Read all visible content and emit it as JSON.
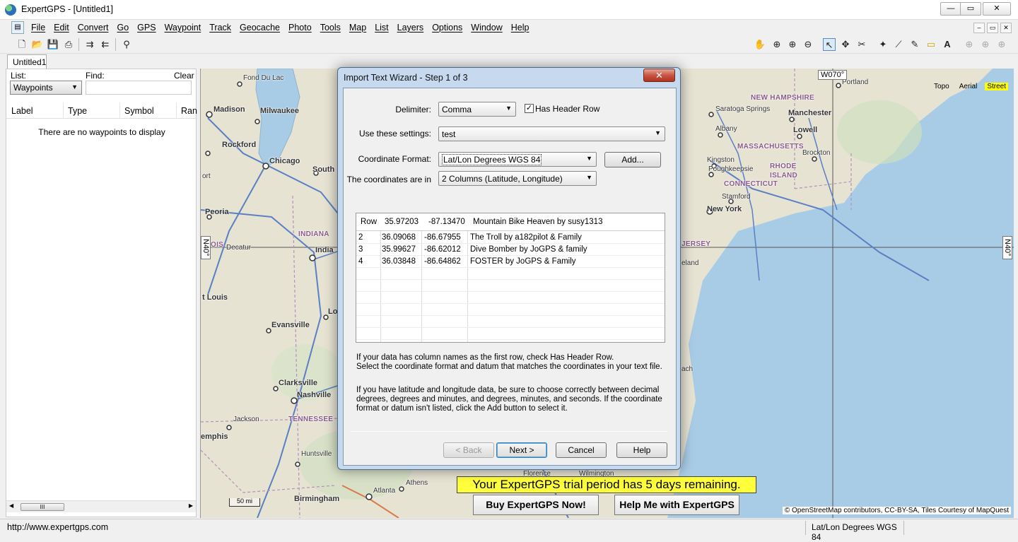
{
  "window": {
    "title": "ExpertGPS - [Untitled1]",
    "controls": {
      "minimize": "—",
      "restore": "▭",
      "close": "✕"
    }
  },
  "menu": [
    "File",
    "Edit",
    "Convert",
    "Go",
    "GPS",
    "Waypoint",
    "Track",
    "Geocache",
    "Photo",
    "Tools",
    "Map",
    "List",
    "Layers",
    "Options",
    "Window",
    "Help"
  ],
  "document_tab": "Untitled1",
  "left_panel": {
    "list_label": "List:",
    "find_label": "Find:",
    "clear_label": "Clear",
    "list_value": "Waypoints",
    "columns": [
      "Label",
      "Type",
      "Symbol",
      "Ran"
    ],
    "empty_message": "There are no waypoints to display",
    "scroll_thumb": "III"
  },
  "map": {
    "types": [
      "Topo",
      "Aerial",
      "Street"
    ],
    "active_type": "Street",
    "lon_tag": "W070°",
    "lat_tag_left": "N40°",
    "lat_tag_right": "N40°",
    "scale": "50 mi",
    "attribution": "© OpenStreetMap contributors, CC-BY-SA, Tiles Courtesy of MapQuest",
    "labels": {
      "fond_du_lac": "Fond Du Lac",
      "madison": "Madison",
      "milwaukee": "Milwaukee",
      "rockford": "Rockford",
      "chicago": "Chicago",
      "south": "South",
      "ort": "ort",
      "peoria": "Peoria",
      "indiana": "INDIANA",
      "ois": "OIS",
      "decatur": "Decatur",
      "india": "India",
      "st_louis": "t Louis",
      "lo": "Lo",
      "evansville": "Evansville",
      "clarksville": "Clarksville",
      "nashville": "Nashville",
      "jackson": "Jackson",
      "tennessee": "TENNESSEE",
      "emphis": "emphis",
      "huntsville": "Huntsville",
      "athens": "Athens",
      "atlanta": "Atlanta",
      "birmingham": "Birmingham",
      "florence": "Florence",
      "wilmington": "Wilmington",
      "portland": "Portland",
      "new_hampshire": "NEW HAMPSHIRE",
      "saratoga": "Saratoga Springs",
      "manchester": "Manchester",
      "albany": "Albany",
      "lowell": "Lowell",
      "massachusetts": "MASSACHUSETTS",
      "kingston": "Kingston",
      "brockton": "Brockton",
      "poughkeepsie": "Poughkeepsie",
      "rhode_island_1": "RHODE",
      "rhode_island_2": "ISLAND",
      "connecticut": "CONNECTICUT",
      "stamford": "Stamford",
      "new_york": "New York",
      "jersey": "JERSEY",
      "eland": "eland",
      "ach": "ach"
    }
  },
  "trial": {
    "banner": "Your ExpertGPS trial period has 5 days remaining.",
    "buy_button": "Buy ExpertGPS Now!",
    "help_button": "Help Me with ExpertGPS"
  },
  "dialog": {
    "title": "Import Text Wizard - Step 1 of 3",
    "close": "✕",
    "delimiter_label": "Delimiter:",
    "delimiter_value": "Comma",
    "has_header_label": "Has Header Row",
    "has_header_checked": true,
    "settings_label": "Use these settings:",
    "settings_value": "test",
    "coord_format_label": "Coordinate Format:",
    "coord_format_value": "Lat/Lon Degrees WGS 84",
    "add_button": "Add...",
    "coords_in_label": "The coordinates are in",
    "coords_in_value": "2 Columns (Latitude, Longitude)",
    "grid": {
      "header": [
        "Row",
        "35.97203",
        "-87.13470",
        "Mountain Bike Heaven by susy1313"
      ],
      "rows": [
        [
          "2",
          "36.09068",
          "-86.67955",
          "The Troll by a182pilot & Family"
        ],
        [
          "3",
          "35.99627",
          "-86.62012",
          "Dive Bomber by JoGPS & family"
        ],
        [
          "4",
          "36.03848",
          "-86.64862",
          "FOSTER by JoGPS & Family"
        ]
      ]
    },
    "help1": "If your data has column names as the first row, check Has Header Row.\nSelect the coordinate format and datum that matches the coordinates in your text file.",
    "help2": "If you have latitude and longitude data, be sure to choose correctly between decimal degrees, degrees and minutes, and degrees, minutes, and seconds.  If the coordinate format or datum isn't listed, click the Add button to select it.",
    "back_button": "< Back",
    "next_button": "Next >",
    "cancel_button": "Cancel",
    "help_button": "Help"
  },
  "status": {
    "url": "http://www.expertgps.com",
    "coord_format": "Lat/Lon Degrees WGS 84"
  }
}
